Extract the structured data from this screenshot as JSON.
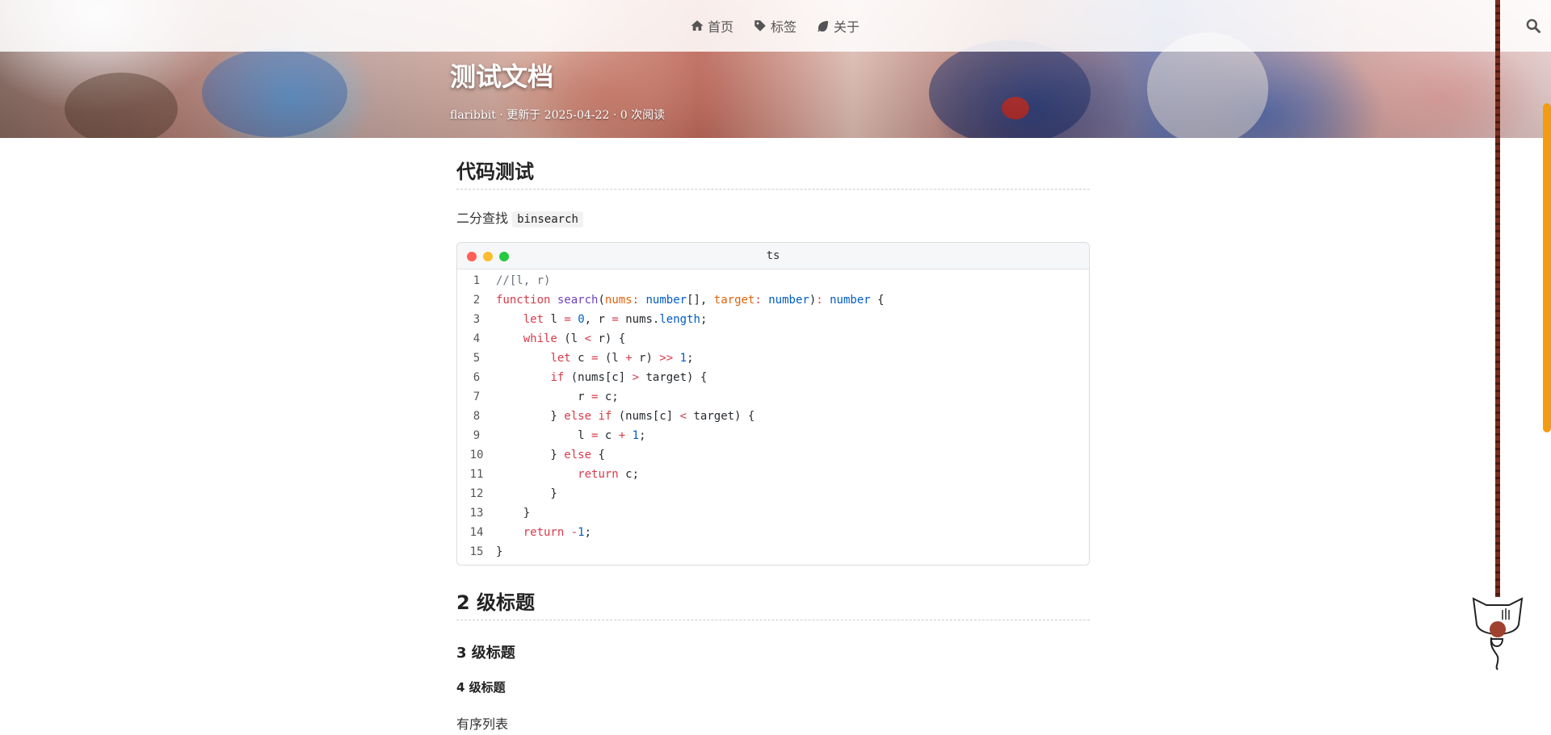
{
  "nav": {
    "items": [
      {
        "label": "首页",
        "icon": "home-icon"
      },
      {
        "label": "标签",
        "icon": "tag-icon"
      },
      {
        "label": "关于",
        "icon": "leaf-icon"
      }
    ],
    "search_icon": "search-icon"
  },
  "post": {
    "title": "测试文档",
    "meta": "flaribbit · 更新于 2025-04-22 · 0 次阅读"
  },
  "article": {
    "h2_code": "代码测试",
    "para_prefix": "二分查找 ",
    "inline_code": "binsearch",
    "code_lang": "ts",
    "code_lines": [
      {
        "n": "1",
        "tokens": [
          [
            "com",
            "//[l, r)"
          ]
        ]
      },
      {
        "n": "2",
        "tokens": [
          [
            "kw",
            "function"
          ],
          [
            "",
            " "
          ],
          [
            "fn",
            "search"
          ],
          [
            "",
            "("
          ],
          [
            "par",
            "nums"
          ],
          [
            "op",
            ":"
          ],
          [
            "",
            " "
          ],
          [
            "ty",
            "number"
          ],
          [
            "",
            "[], "
          ],
          [
            "par",
            "target"
          ],
          [
            "op",
            ":"
          ],
          [
            "",
            " "
          ],
          [
            "ty",
            "number"
          ],
          [
            "",
            ")"
          ],
          [
            "op",
            ":"
          ],
          [
            "",
            " "
          ],
          [
            "ty",
            "number"
          ],
          [
            "",
            " {"
          ]
        ]
      },
      {
        "n": "3",
        "tokens": [
          [
            "",
            "    "
          ],
          [
            "kw",
            "let"
          ],
          [
            "",
            " l "
          ],
          [
            "op",
            "="
          ],
          [
            "",
            " "
          ],
          [
            "num",
            "0"
          ],
          [
            "",
            ", r "
          ],
          [
            "op",
            "="
          ],
          [
            "",
            " nums."
          ],
          [
            "prop",
            "length"
          ],
          [
            "",
            ";"
          ]
        ]
      },
      {
        "n": "4",
        "tokens": [
          [
            "",
            "    "
          ],
          [
            "kw",
            "while"
          ],
          [
            "",
            " (l "
          ],
          [
            "op",
            "<"
          ],
          [
            "",
            " r) {"
          ]
        ]
      },
      {
        "n": "5",
        "tokens": [
          [
            "",
            "        "
          ],
          [
            "kw",
            "let"
          ],
          [
            "",
            " c "
          ],
          [
            "op",
            "="
          ],
          [
            "",
            " (l "
          ],
          [
            "op",
            "+"
          ],
          [
            "",
            " r) "
          ],
          [
            "op",
            ">>"
          ],
          [
            "",
            " "
          ],
          [
            "num",
            "1"
          ],
          [
            "",
            ";"
          ]
        ]
      },
      {
        "n": "6",
        "tokens": [
          [
            "",
            "        "
          ],
          [
            "kw",
            "if"
          ],
          [
            "",
            " (nums[c] "
          ],
          [
            "op",
            ">"
          ],
          [
            "",
            " target) {"
          ]
        ]
      },
      {
        "n": "7",
        "tokens": [
          [
            "",
            "            r "
          ],
          [
            "op",
            "="
          ],
          [
            "",
            " c;"
          ]
        ]
      },
      {
        "n": "8",
        "tokens": [
          [
            "",
            "        } "
          ],
          [
            "kw",
            "else"
          ],
          [
            "",
            " "
          ],
          [
            "kw",
            "if"
          ],
          [
            "",
            " (nums[c] "
          ],
          [
            "op",
            "<"
          ],
          [
            "",
            " target) {"
          ]
        ]
      },
      {
        "n": "9",
        "tokens": [
          [
            "",
            "            l "
          ],
          [
            "op",
            "="
          ],
          [
            "",
            " c "
          ],
          [
            "op",
            "+"
          ],
          [
            "",
            " "
          ],
          [
            "num",
            "1"
          ],
          [
            "",
            ";"
          ]
        ]
      },
      {
        "n": "10",
        "tokens": [
          [
            "",
            "        } "
          ],
          [
            "kw",
            "else"
          ],
          [
            "",
            " {"
          ]
        ]
      },
      {
        "n": "11",
        "tokens": [
          [
            "",
            "            "
          ],
          [
            "kw",
            "return"
          ],
          [
            "",
            " c;"
          ]
        ]
      },
      {
        "n": "12",
        "tokens": [
          [
            "",
            "        }"
          ]
        ]
      },
      {
        "n": "13",
        "tokens": [
          [
            "",
            "    }"
          ]
        ]
      },
      {
        "n": "14",
        "tokens": [
          [
            "",
            "    "
          ],
          [
            "kw",
            "return"
          ],
          [
            "",
            " "
          ],
          [
            "op",
            "-"
          ],
          [
            "num",
            "1"
          ],
          [
            "",
            ";"
          ]
        ]
      },
      {
        "n": "15",
        "tokens": [
          [
            "",
            "}"
          ]
        ]
      }
    ],
    "h2_second": "2 级标题",
    "h3": "3 级标题",
    "h4": "4 级标题",
    "para_list": "有序列表"
  },
  "colors": {
    "accent": "#f39c12",
    "rope": "#7a2e1c"
  }
}
